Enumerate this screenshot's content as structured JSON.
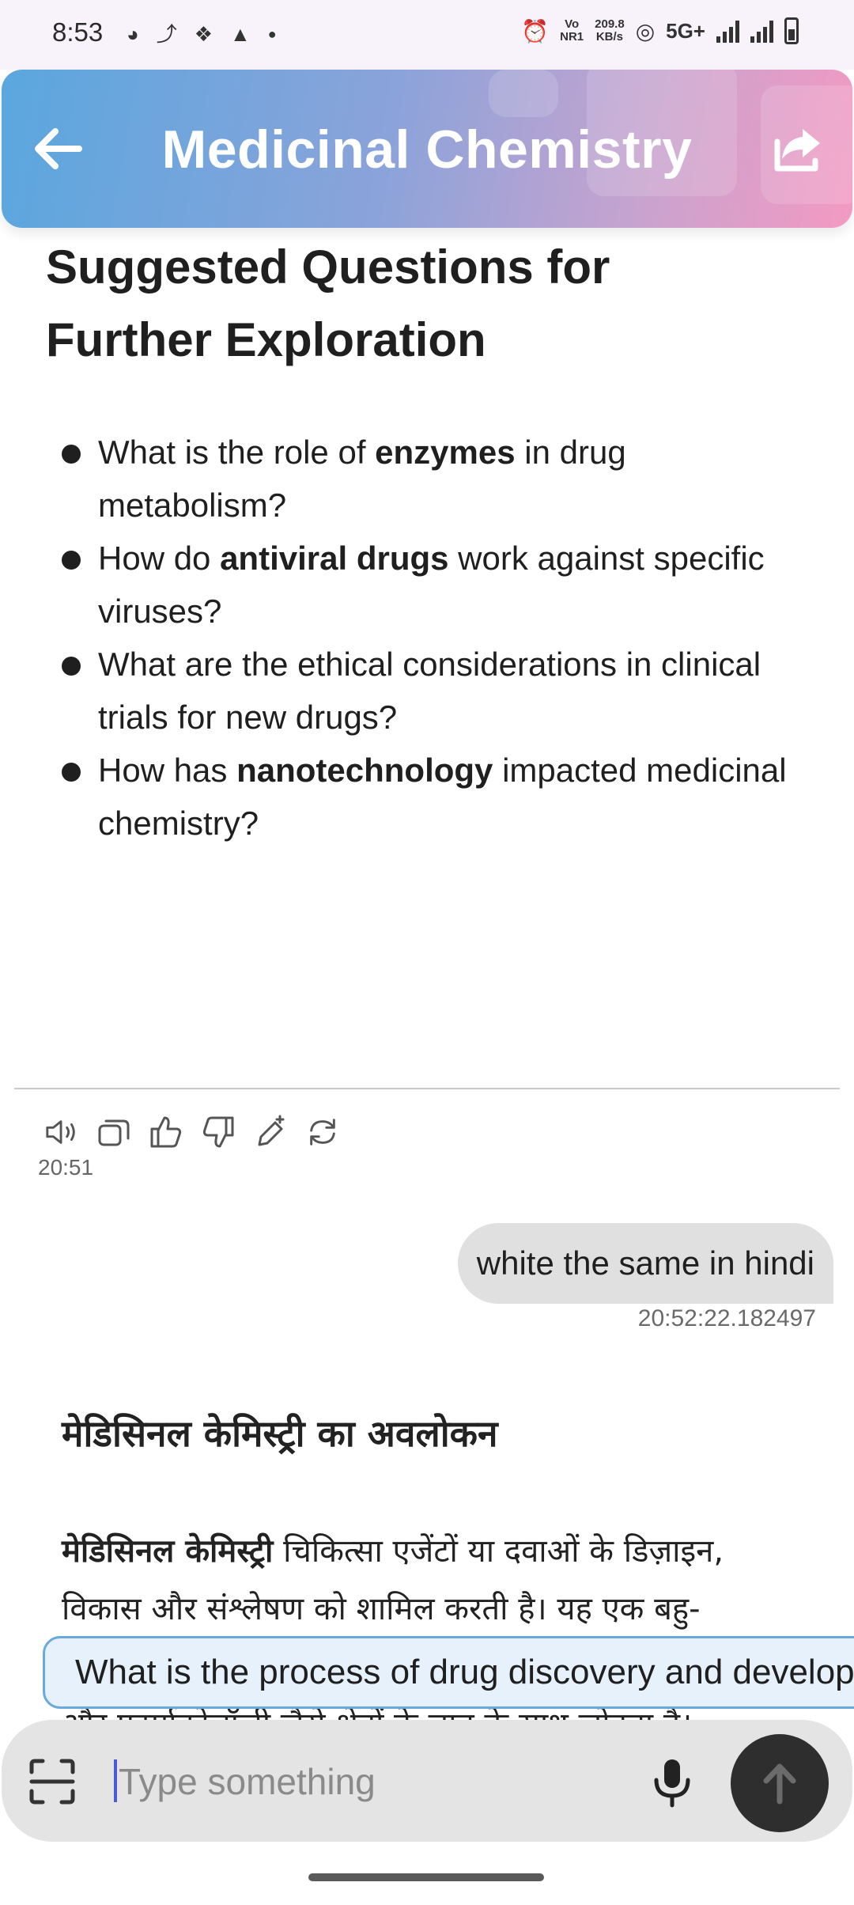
{
  "status_bar": {
    "time": "8:53",
    "net_type_top": "Vo",
    "net_type_bottom": "NR1",
    "speed_top": "209.8",
    "speed_bottom": "KB/s",
    "network": "5G+"
  },
  "header": {
    "title": "Medicinal Chemistry",
    "gradient_start": "#5aa7de",
    "gradient_end": "#f39ac2"
  },
  "assistant_message": {
    "heading": "Suggested Questions for Further Exploration",
    "questions": [
      {
        "pre": "What is the role of ",
        "bold": "enzymes",
        "post": " in drug metabolism?"
      },
      {
        "pre": "How do ",
        "bold": "antiviral drugs",
        "post": " work against specific viruses?"
      },
      {
        "pre": "What are the ethical considerations in clinical trials for new drugs?",
        "bold": "",
        "post": ""
      },
      {
        "pre": "How has ",
        "bold": "nanotechnology",
        "post": " impacted medicinal chemistry?"
      }
    ],
    "time": "20:51",
    "actions": [
      "speaker-icon",
      "copy-icon",
      "thumbs-up-icon",
      "thumbs-down-icon",
      "edit-sparkle-icon",
      "regenerate-icon"
    ]
  },
  "user_message": {
    "text": "white the same in hindi",
    "timestamp": "20:52:22.182497"
  },
  "hindi_response": {
    "heading": "मेडिसिनल केमिस्ट्री का अवलोकन",
    "body_bold": "मेडिसिनल केमिस्ट्री",
    "body_rest": " चिकित्सा एजेंटों या दवाओं के डिज़ाइन, विकास और संश्लेषण को शामिल करती है। यह एक बहु-विषयात्मक क्षेत्र है जो रासायनिक अनुसंधान को जीवविज्ञान और फार्माकोलॉजी जैसे क्षेत्रों के ज्ञान के साथ जोड़ता है।"
  },
  "suggestion_chip": {
    "text": "What is the process of drug discovery and development?"
  },
  "input_bar": {
    "placeholder": "Type something",
    "value": ""
  }
}
